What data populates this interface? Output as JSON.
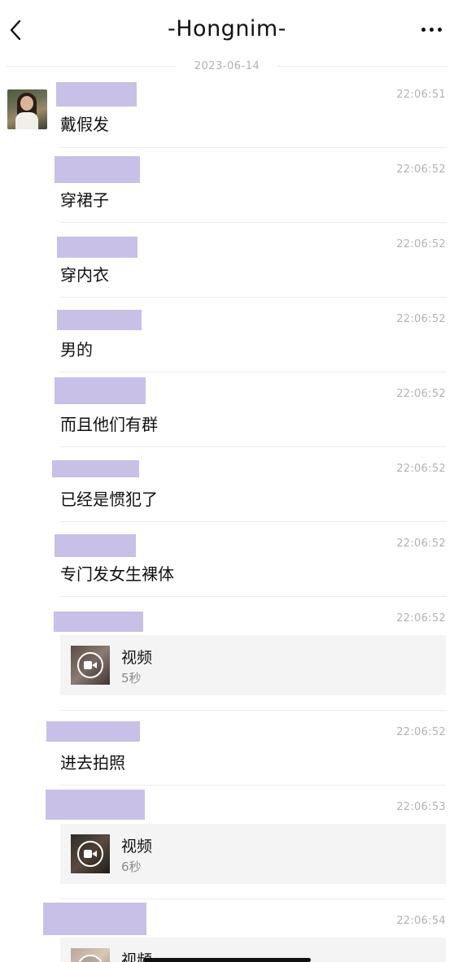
{
  "header": {
    "title": "-Hongnim-",
    "back_icon": "chevron-left-icon",
    "more_icon": "more-dots-icon"
  },
  "date_divider": "2023-06-14",
  "colors": {
    "redaction": "#c8c0e6",
    "timestamp": "#b2b2b2",
    "card_bg": "#f4f4f4"
  },
  "messages": [
    {
      "type": "text",
      "time": "22:06:51",
      "text": "戴假发"
    },
    {
      "type": "text",
      "time": "22:06:52",
      "text": "穿裙子"
    },
    {
      "type": "text",
      "time": "22:06:52",
      "text": "穿内衣"
    },
    {
      "type": "text",
      "time": "22:06:52",
      "text": "男的"
    },
    {
      "type": "text",
      "time": "22:06:52",
      "text": "而且他们有群"
    },
    {
      "type": "text",
      "time": "22:06:52",
      "text": "已经是惯犯了"
    },
    {
      "type": "text",
      "time": "22:06:52",
      "text": "专门发女生裸体"
    },
    {
      "type": "video",
      "time": "22:06:52",
      "label": "视频",
      "duration": "5秒"
    },
    {
      "type": "text",
      "time": "22:06:52",
      "text": "进去拍照"
    },
    {
      "type": "video",
      "time": "22:06:53",
      "label": "视频",
      "duration": "6秒"
    },
    {
      "type": "video",
      "time": "22:06:54",
      "label": "视频",
      "duration": ""
    }
  ]
}
